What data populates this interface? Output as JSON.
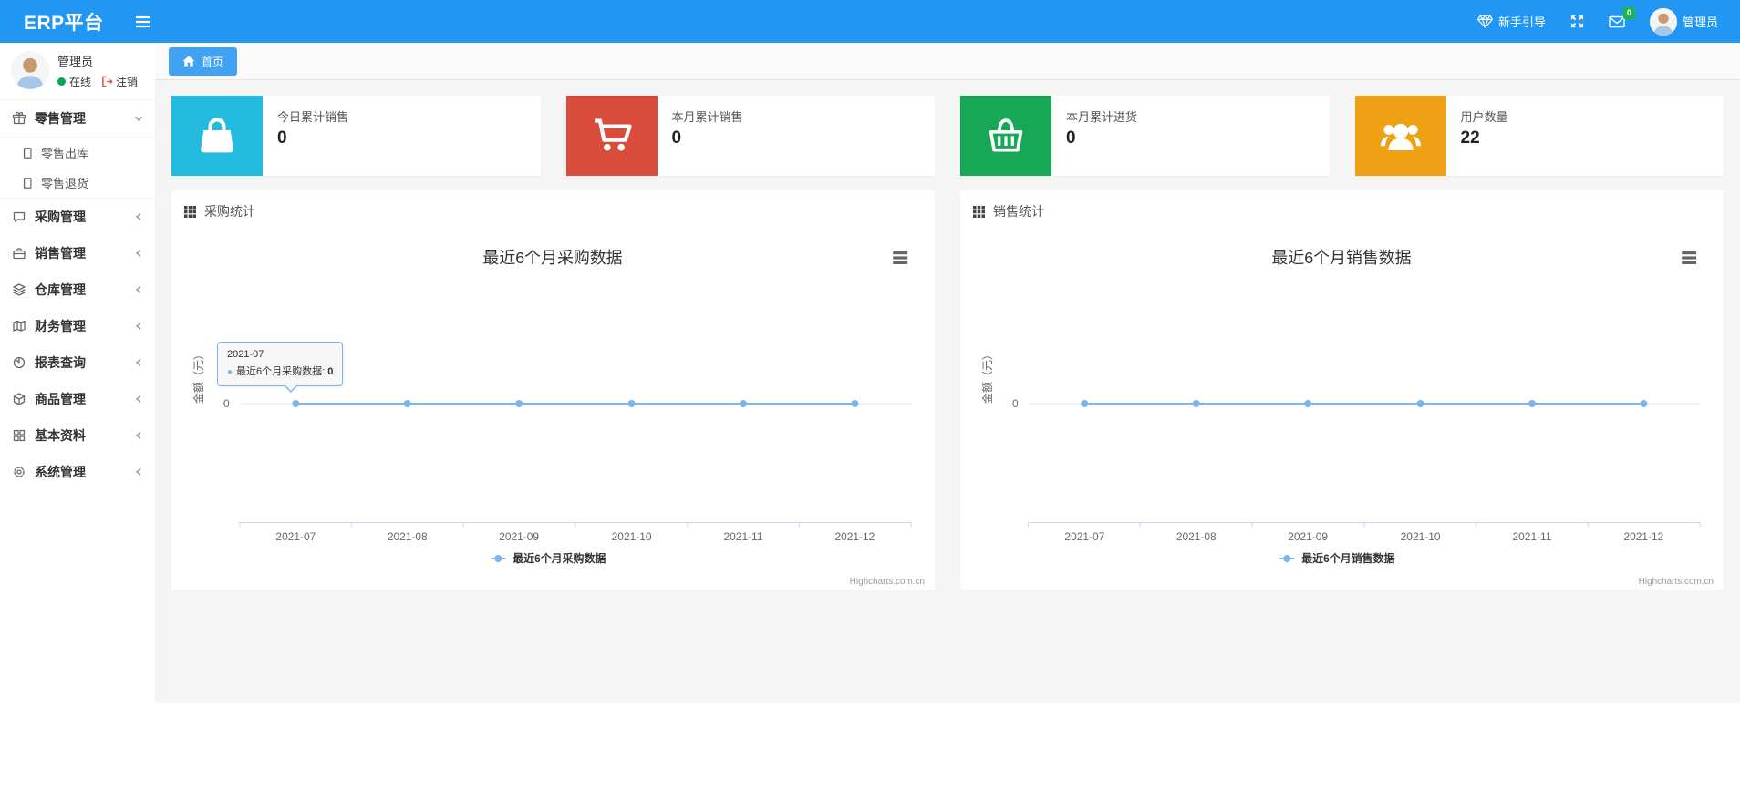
{
  "navbar": {
    "brand": "ERP平台",
    "guide_label": "新手引导",
    "mail_badge": "0",
    "username": "管理员"
  },
  "sidebar": {
    "user": {
      "name": "管理员",
      "status_online": "在线",
      "logout_label": "注销"
    },
    "menu": [
      {
        "label": "零售管理",
        "icon": "gift-icon",
        "children": [
          "零售出库",
          "零售退货"
        ]
      },
      {
        "label": "采购管理",
        "icon": "chat-icon"
      },
      {
        "label": "销售管理",
        "icon": "briefcase-icon"
      },
      {
        "label": "仓库管理",
        "icon": "layers-icon"
      },
      {
        "label": "财务管理",
        "icon": "map-book-icon"
      },
      {
        "label": "报表查询",
        "icon": "pie-chart-icon"
      },
      {
        "label": "商品管理",
        "icon": "cube-icon"
      },
      {
        "label": "基本资料",
        "icon": "grid-icon"
      },
      {
        "label": "系统管理",
        "icon": "gear-icon"
      }
    ]
  },
  "tabs": {
    "home": "首页"
  },
  "cards": [
    {
      "label": "今日累计销售",
      "value": "0",
      "color": "#24b9de",
      "icon": "shopping-bag-icon"
    },
    {
      "label": "本月累计销售",
      "value": "0",
      "color": "#d94c3b",
      "icon": "cart-icon"
    },
    {
      "label": "本月累计进货",
      "value": "0",
      "color": "#18a657",
      "icon": "basket-icon"
    },
    {
      "label": "用户数量",
      "value": "22",
      "color": "#efa116",
      "icon": "users-icon"
    }
  ],
  "panels": [
    {
      "title": "采购统计"
    },
    {
      "title": "销售统计"
    }
  ],
  "chart_data": [
    {
      "type": "line",
      "title": "最近6个月采购数据",
      "categories": [
        "2021-07",
        "2021-08",
        "2021-09",
        "2021-10",
        "2021-11",
        "2021-12"
      ],
      "series": [
        {
          "name": "最近6个月采购数据",
          "values": [
            0,
            0,
            0,
            0,
            0,
            0
          ]
        }
      ],
      "xlabel": "",
      "ylabel": "金额（元）",
      "yticks": [
        "0"
      ],
      "line_color": "#7cb5ec",
      "grid": true,
      "legend_position": "bottom",
      "credits": "Highcharts.com.cn",
      "tooltip": {
        "date": "2021-07",
        "marker": "●",
        "label": "最近6个月采购数据: ",
        "value": "0"
      }
    },
    {
      "type": "line",
      "title": "最近6个月销售数据",
      "categories": [
        "2021-07",
        "2021-08",
        "2021-09",
        "2021-10",
        "2021-11",
        "2021-12"
      ],
      "series": [
        {
          "name": "最近6个月销售数据",
          "values": [
            0,
            0,
            0,
            0,
            0,
            0
          ]
        }
      ],
      "xlabel": "",
      "ylabel": "金额（元）",
      "yticks": [
        "0"
      ],
      "line_color": "#7cb5ec",
      "grid": true,
      "legend_position": "bottom",
      "credits": "Highcharts.com.cn"
    }
  ]
}
